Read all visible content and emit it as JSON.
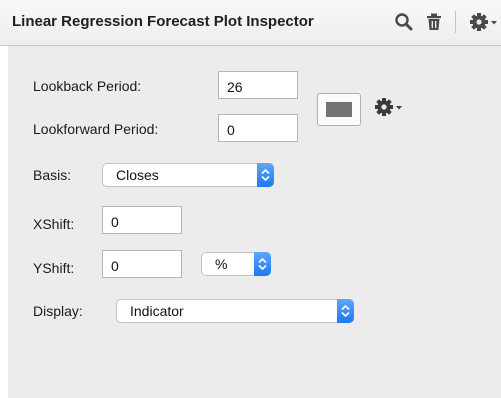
{
  "title": "Linear Regression Forecast Plot Inspector",
  "toolbar": {
    "search_icon": "search-icon",
    "trash_icon": "trash-icon",
    "gear_icon": "gear-menu-icon"
  },
  "fields": {
    "lookback": {
      "label": "Lookback Period:",
      "value": "26"
    },
    "lookforward": {
      "label": "Lookforward Period:",
      "value": "0"
    },
    "basis": {
      "label": "Basis:",
      "value": "Closes"
    },
    "xshift": {
      "label": "XShift:",
      "value": "0"
    },
    "yshift": {
      "label": "YShift:",
      "value": "0",
      "unit": "%"
    },
    "display": {
      "label": "Display:",
      "value": "Indicator"
    }
  },
  "colors": {
    "plot_color": "#737373",
    "stepper_accent": "#1d79f2"
  }
}
